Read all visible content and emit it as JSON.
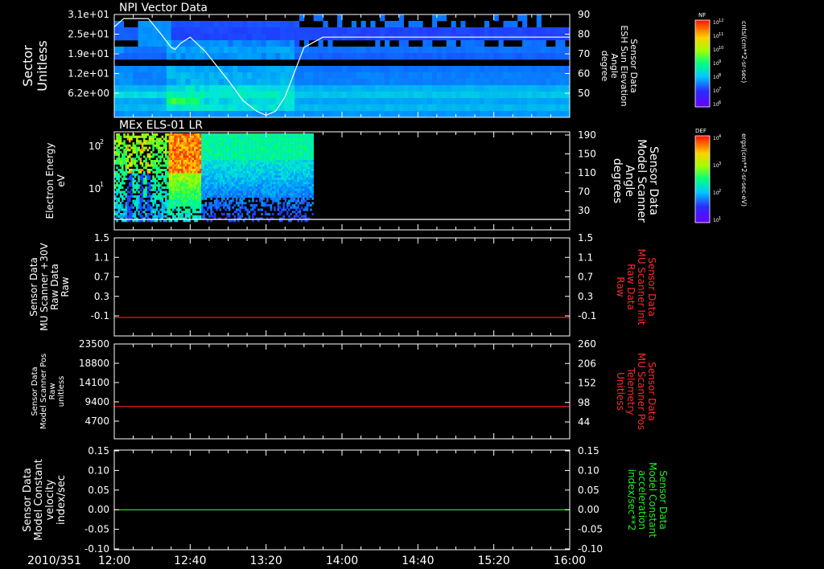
{
  "colors": {
    "bg": "#000000",
    "axis": "#ffffff",
    "red_line": "#ff2020",
    "green_line": "#22dd22",
    "right_label_red": "#ff2a2a",
    "right_label_green": "#22ee22"
  },
  "footer": {
    "date_label": "2010/351",
    "time_ticks": [
      "12:00",
      "12:40",
      "13:20",
      "14:00",
      "14:40",
      "15:20",
      "16:00"
    ]
  },
  "chart_data": [
    {
      "id": "panel1",
      "type": "heatmap",
      "title": "NPI Vector Data",
      "ylabel": [
        "Sector",
        "Unitless"
      ],
      "y_ticks": [
        "3.1e+01",
        "2.5e+01",
        "1.9e+01",
        "1.2e+01",
        "6.2e+00"
      ],
      "right_ylabel": [
        "Sensor Data",
        "ESH Sun Elevation",
        "Angle",
        "degree"
      ],
      "right_ticks": [
        "90",
        "80",
        "70",
        "60",
        "50"
      ],
      "ylim_right": [
        40,
        90
      ],
      "colorbar": {
        "label": "NF",
        "units": "cnts/(cm**2-sr-sec)",
        "ticks": [
          "10^12",
          "10^11",
          "10^10",
          "10^9",
          "10^8",
          "10^7",
          "10^6"
        ]
      },
      "overlay_line": {
        "name": "ESH Sun Elevation Angle",
        "x_minutes": [
          0,
          5,
          18,
          25,
          30,
          32,
          35,
          40,
          48,
          60,
          68,
          75,
          80,
          85,
          90,
          95,
          100,
          110,
          240
        ],
        "y": [
          84,
          88,
          88,
          80,
          74,
          73,
          76,
          79,
          72,
          58,
          48,
          43,
          41,
          43,
          50,
          62,
          74,
          79,
          79
        ]
      }
    },
    {
      "id": "panel2",
      "type": "heatmap",
      "title": "MEx ELS-01 LR",
      "ylabel": [
        "Electron Energy",
        "eV"
      ],
      "y_ticks": [
        "10^2",
        "10^1"
      ],
      "right_ylabel": [
        "Sensor Data",
        "Model Scanner",
        "Angle",
        "degrees"
      ],
      "right_ticks": [
        "190",
        "150",
        "110",
        "70",
        "30"
      ],
      "colorbar": {
        "label": "DEF",
        "units": "ergs/(cm**2-sr-sec-eV)",
        "ticks": [
          "10^4",
          "10^3",
          "10^2",
          "10^1"
        ]
      },
      "data_extent_minutes": [
        0,
        105
      ]
    },
    {
      "id": "panel3",
      "type": "line",
      "ylabel": [
        "Sensor Data",
        "MU Scanner +30V",
        "Raw Data",
        "Raw"
      ],
      "y_ticks": [
        "1.5",
        "1.1",
        "0.7",
        "0.3",
        "-0.1"
      ],
      "ylim": [
        -0.35,
        1.5
      ],
      "right_ylabel": [
        "Sensor Data",
        "MU Scanner Init",
        "Raw Data",
        "Raw"
      ],
      "right_ticks": [
        "1.5",
        "1.1",
        "0.7",
        "0.3",
        "-0.1"
      ],
      "series": [
        {
          "values_constant": 0.0,
          "color": "red"
        }
      ]
    },
    {
      "id": "panel4",
      "type": "line",
      "ylabel": [
        "Sensor Data",
        "Model Scanner Pos",
        "Raw",
        "unitless"
      ],
      "y_ticks": [
        "23500",
        "18800",
        "14100",
        "9400",
        "4700"
      ],
      "ylim": [
        0,
        23500
      ],
      "right_ylabel": [
        "Sensor Data",
        "MU Scanner Pos",
        "Telemetry",
        "Unitless"
      ],
      "right_ticks": [
        "260",
        "206",
        "152",
        "98",
        "44"
      ],
      "series": [
        {
          "values_constant": 8000,
          "color": "red"
        }
      ]
    },
    {
      "id": "panel5",
      "type": "line",
      "ylabel": [
        "Sensor Data",
        "Model Constant",
        "velocity",
        "index/sec"
      ],
      "y_ticks": [
        "0.15",
        "0.10",
        "0.05",
        "0.00",
        "-0.05",
        "-0.10"
      ],
      "ylim": [
        -0.1,
        0.15
      ],
      "right_ylabel": [
        "Sensor Data",
        "Model Constant",
        "acceleration",
        "index/sec**2"
      ],
      "right_ticks": [
        "0.15",
        "0.10",
        "0.05",
        "0.00",
        "-0.05",
        "-0.10"
      ],
      "series": [
        {
          "values_constant": 0.0,
          "color": "green"
        }
      ]
    }
  ]
}
